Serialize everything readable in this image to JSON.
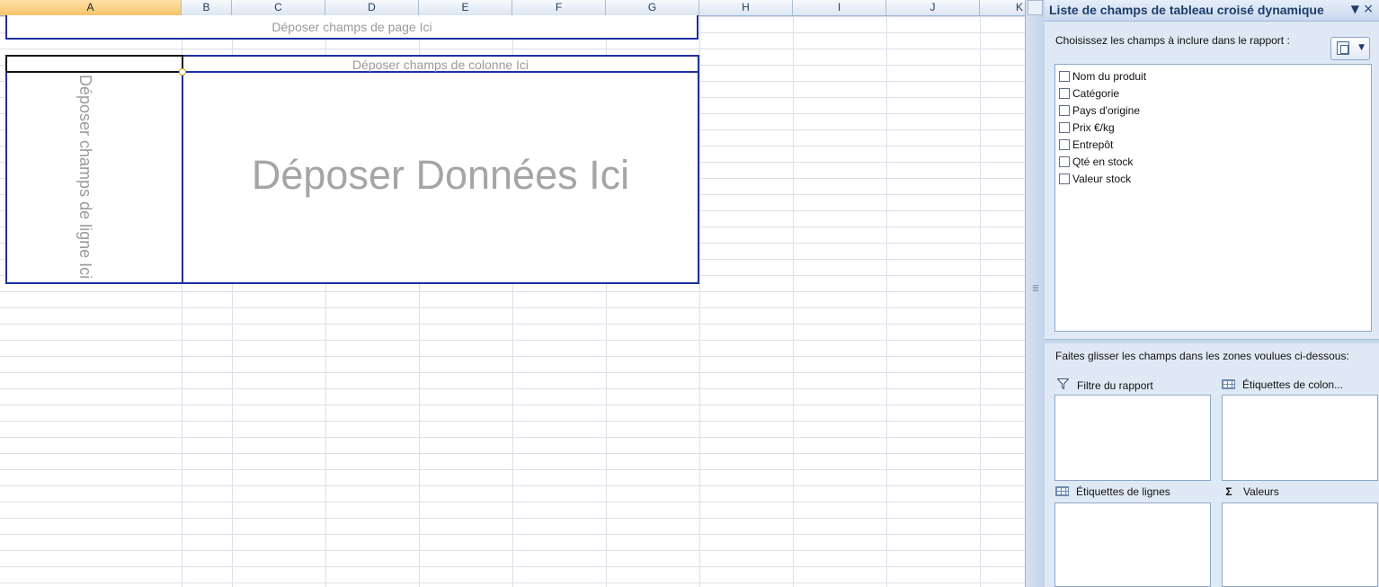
{
  "sheet": {
    "columns": [
      "A",
      "B",
      "C",
      "D",
      "E",
      "F",
      "G",
      "H",
      "I",
      "J",
      "K"
    ],
    "selected_column": "A",
    "pivot_drop_zones": {
      "page": "Déposer champs de page Ici",
      "column": "Déposer champs de colonne Ici",
      "row": "Déposer champs de ligne Ici",
      "data": "Déposer Données Ici"
    }
  },
  "panel": {
    "title": "Liste de champs de tableau croisé dynamique",
    "choose_label": "Choisissez les champs à inclure dans le rapport :",
    "fields": [
      {
        "label": "Nom du produit",
        "checked": false
      },
      {
        "label": "Catégorie",
        "checked": false
      },
      {
        "label": "Pays d'origine",
        "checked": false
      },
      {
        "label": "Prix €/kg",
        "checked": false
      },
      {
        "label": "Entrepôt",
        "checked": false
      },
      {
        "label": "Qté en stock",
        "checked": false
      },
      {
        "label": "Valeur stock",
        "checked": false
      }
    ],
    "drag_label": "Faites glisser les champs dans les zones voulues ci-dessous:",
    "areas": {
      "report_filter": "Filtre du rapport",
      "column_labels": "Étiquettes de colon...",
      "row_labels": "Étiquettes de lignes",
      "values": "Valeurs"
    },
    "icons": {
      "filter": "filter-icon",
      "column": "grid-icon",
      "row": "grid-icon",
      "values": "sigma-icon",
      "layout": "field-layout-icon",
      "dropdown": "chevron-down-icon",
      "close": "close-icon"
    }
  }
}
